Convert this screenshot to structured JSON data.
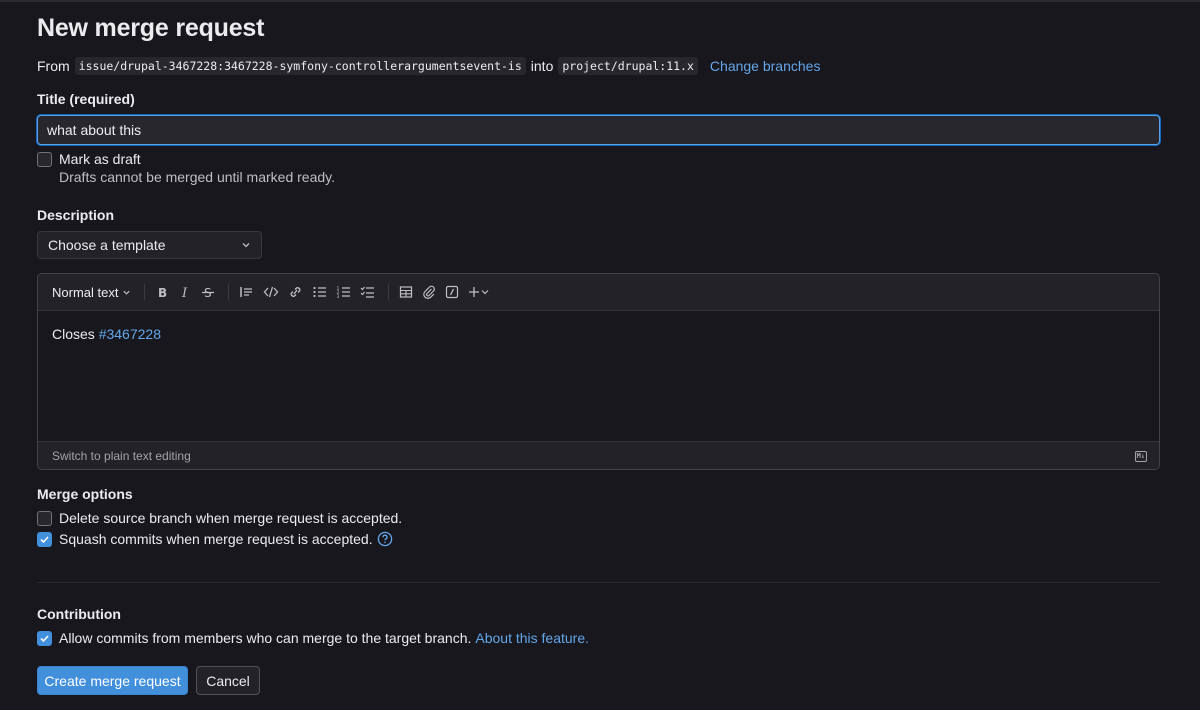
{
  "header": {
    "title": "New merge request"
  },
  "branches": {
    "from_label": "From",
    "source_branch": "issue/drupal-3467228:3467228-symfony-controllerargumentsevent-is",
    "into_label": "into",
    "target_branch": "project/drupal:11.x",
    "change_link": "Change branches"
  },
  "title_field": {
    "label": "Title (required)",
    "value": "what about this",
    "draft_label": "Mark as draft",
    "draft_checked": false,
    "draft_help": "Drafts cannot be merged until marked ready."
  },
  "description": {
    "label": "Description",
    "template_placeholder": "Choose a template",
    "toolbar": {
      "text_style": "Normal text",
      "icons": [
        "bold-icon",
        "italic-icon",
        "strikethrough-icon",
        "blockquote-icon",
        "code-icon",
        "link-icon",
        "bullet-list-icon",
        "numbered-list-icon",
        "task-list-icon",
        "table-icon",
        "attach-icon",
        "slash-command-icon",
        "more-icon"
      ]
    },
    "body_prefix": "Closes",
    "body_link": "#3467228",
    "switch_link": "Switch to plain text editing",
    "markdown_badge": "M↓"
  },
  "merge_options": {
    "label": "Merge options",
    "delete_source": {
      "label": "Delete source branch when merge request is accepted.",
      "checked": false
    },
    "squash": {
      "label": "Squash commits when merge request is accepted.",
      "checked": true
    }
  },
  "contribution": {
    "label": "Contribution",
    "allow_commits": {
      "label": "Allow commits from members who can merge to the target branch.",
      "checked": true
    },
    "about_link": "About this feature."
  },
  "actions": {
    "create_label": "Create merge request",
    "cancel_label": "Cancel"
  },
  "colors": {
    "background": "#18171d",
    "accent": "#428fdc",
    "link": "#63a6e9",
    "text": "#ececef"
  }
}
